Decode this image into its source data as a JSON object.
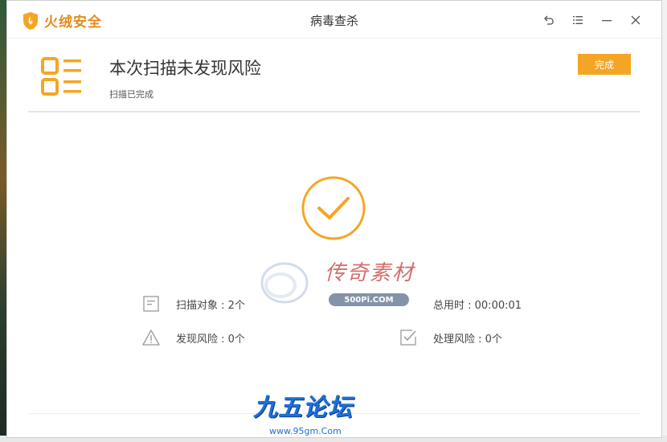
{
  "app": {
    "brand": "火绒安全",
    "window_title": "病毒查杀"
  },
  "result": {
    "headline": "本次扫描未发现风险",
    "status": "扫描已完成",
    "done_label": "完成"
  },
  "stats": {
    "scanned_objects": "扫描对象 : 2个",
    "total_time": "总用时 : 00:00:01",
    "found_risks": "发现风险 : 0个",
    "handled_risks": "处理风险 : 0个"
  },
  "watermarks": {
    "wm1_text": "传奇素材",
    "wm1_url": "500Pi.COM",
    "wm2_text": "九五论坛",
    "wm2_url": "www.95gm.Com"
  },
  "colors": {
    "accent": "#f5a524",
    "brand": "#e8891c"
  },
  "icons": [
    "shield-logo-icon",
    "back-icon",
    "menu-icon",
    "minimize-icon",
    "close-icon",
    "list-icon",
    "check-circle-icon",
    "document-icon",
    "clock-icon",
    "warning-icon",
    "checkbox-icon"
  ]
}
